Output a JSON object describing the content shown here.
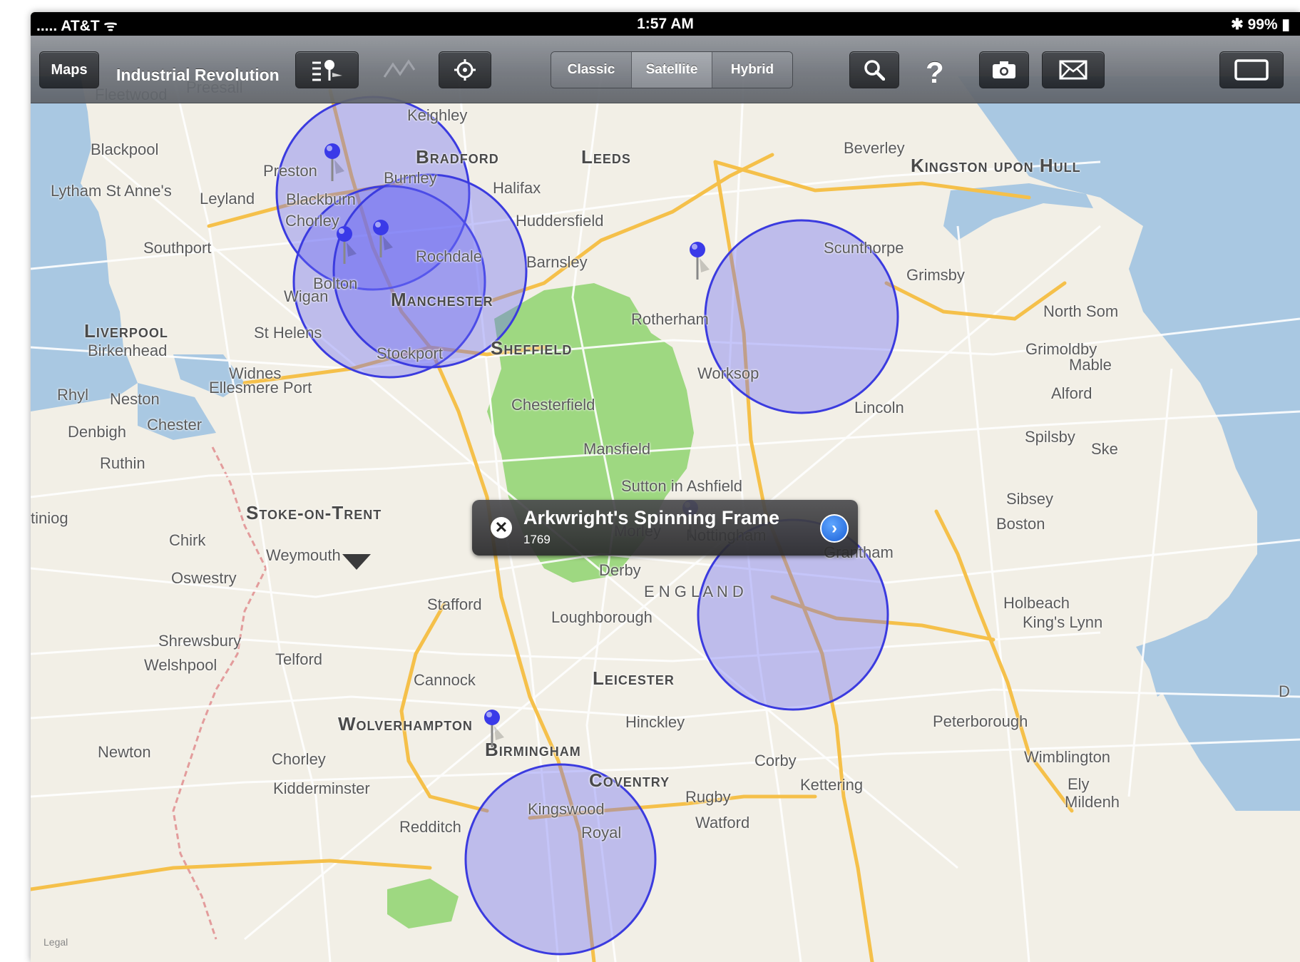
{
  "status_bar": {
    "carrier": "..... AT&T ᯤ",
    "time": "1:57 AM",
    "battery": "✱ 99% ▮"
  },
  "toolbar": {
    "maps_button": "Maps",
    "title": "Industrial Revolution",
    "icons": [
      "list-pin-icon",
      "route-icon",
      "locate-icon",
      "search-icon",
      "help-icon",
      "camera-icon",
      "mail-icon",
      "fullscreen-icon"
    ],
    "help_label": "?",
    "map_types": [
      "Classic",
      "Satellite",
      "Hybrid"
    ],
    "selected_map_type": "Satellite"
  },
  "map": {
    "labels": [
      {
        "text": "Fleetwood",
        "big": false
      },
      {
        "text": "Preesall",
        "big": false
      },
      {
        "text": "Blackpool",
        "big": false
      },
      {
        "text": "Preston",
        "big": false
      },
      {
        "text": "Lytham St Anne's",
        "big": false
      },
      {
        "text": "Leyland",
        "big": false
      },
      {
        "text": "Blackburn",
        "big": false
      },
      {
        "text": "Burnley",
        "big": false
      },
      {
        "text": "Chorley",
        "big": false
      },
      {
        "text": "Southport",
        "big": false
      },
      {
        "text": "Bolton",
        "big": false
      },
      {
        "text": "Wigan",
        "big": false
      },
      {
        "text": "Rochdale",
        "big": false
      },
      {
        "text": "Keighley",
        "big": false
      },
      {
        "text": "Bradford",
        "big": true
      },
      {
        "text": "Leeds",
        "big": true
      },
      {
        "text": "Halifax",
        "big": false
      },
      {
        "text": "Huddersfield",
        "big": false
      },
      {
        "text": "Barnsley",
        "big": false
      },
      {
        "text": "Manchester",
        "big": true
      },
      {
        "text": "Liverpool",
        "big": true
      },
      {
        "text": "Birkenhead",
        "big": false
      },
      {
        "text": "St Helens",
        "big": false
      },
      {
        "text": "Stockport",
        "big": false
      },
      {
        "text": "Sheffield",
        "big": true
      },
      {
        "text": "Widnes",
        "big": false
      },
      {
        "text": "Ellesmere Port",
        "big": false
      },
      {
        "text": "Rhyl",
        "big": false
      },
      {
        "text": "Neston",
        "big": false
      },
      {
        "text": "Chester",
        "big": false
      },
      {
        "text": "Denbigh",
        "big": false
      },
      {
        "text": "Ruthin",
        "big": false
      },
      {
        "text": "Chesterfield",
        "big": false
      },
      {
        "text": "Mansfield",
        "big": false
      },
      {
        "text": "Sutton in Ashfield",
        "big": false
      },
      {
        "text": "Beverley",
        "big": false
      },
      {
        "text": "Kingston upon Hull",
        "big": true
      },
      {
        "text": "Scunthorpe",
        "big": false
      },
      {
        "text": "Grimsby",
        "big": false
      },
      {
        "text": "Rotherham",
        "big": false
      },
      {
        "text": "Worksop",
        "big": false
      },
      {
        "text": "Lincoln",
        "big": false
      },
      {
        "text": "North Som",
        "big": false
      },
      {
        "text": "Grimoldby",
        "big": false
      },
      {
        "text": "Mable",
        "big": false
      },
      {
        "text": "Alford",
        "big": false
      },
      {
        "text": "Spilsby",
        "big": false
      },
      {
        "text": "Ske",
        "big": false
      },
      {
        "text": "Sibsey",
        "big": false
      },
      {
        "text": "Boston",
        "big": false
      },
      {
        "text": "Grantham",
        "big": false
      },
      {
        "text": "Holbeach",
        "big": false
      },
      {
        "text": "King's Lynn",
        "big": false
      },
      {
        "text": "tiniog",
        "big": false
      },
      {
        "text": "Stoke-on-Trent",
        "big": true
      },
      {
        "text": "Chirk",
        "big": false
      },
      {
        "text": "Weymouth",
        "big": false
      },
      {
        "text": "Oswestry",
        "big": false
      },
      {
        "text": "Stafford",
        "big": false
      },
      {
        "text": "Morley",
        "big": false
      },
      {
        "text": "Nottingham",
        "big": false
      },
      {
        "text": "Derby",
        "big": false
      },
      {
        "text": "E N G L A N D",
        "big": false
      },
      {
        "text": "Loughborough",
        "big": false
      },
      {
        "text": "Shrewsbury",
        "big": false
      },
      {
        "text": "Welshpool",
        "big": false
      },
      {
        "text": "Telford",
        "big": false
      },
      {
        "text": "Cannock",
        "big": false
      },
      {
        "text": "Leicester",
        "big": true
      },
      {
        "text": "Wolverhampton",
        "big": true
      },
      {
        "text": "Hinckley",
        "big": false
      },
      {
        "text": "Birmingham",
        "big": true
      },
      {
        "text": "Peterborough",
        "big": false
      },
      {
        "text": "Wimblington",
        "big": false
      },
      {
        "text": "Newton",
        "big": false
      },
      {
        "text": "Chorley",
        "big": false
      },
      {
        "text": "Corby",
        "big": false
      },
      {
        "text": "Coventry",
        "big": true
      },
      {
        "text": "Kidderminster",
        "big": false
      },
      {
        "text": "Kettering",
        "big": false
      },
      {
        "text": "Ely",
        "big": false
      },
      {
        "text": "Mildenh",
        "big": false
      },
      {
        "text": "Rugby",
        "big": false
      },
      {
        "text": "Kingswood",
        "big": false
      },
      {
        "text": "Watford",
        "big": false
      },
      {
        "text": "Redditch",
        "big": false
      },
      {
        "text": "Royal",
        "big": false
      },
      {
        "text": "D",
        "big": false
      }
    ],
    "legal": "Legal"
  },
  "callout": {
    "title": "Arkwright's Spinning Frame",
    "subtitle": "1769"
  },
  "colors": {
    "circle_fill": "#6a6af5",
    "circle_stroke": "#3b3bdf",
    "pin": "#3a3ae8",
    "water": "#a9c8e2",
    "park": "#8fd46e",
    "land": "#f2efe6",
    "road_major": "#f5c04a",
    "road_minor": "#ffffff",
    "border": "#e39c9c"
  }
}
